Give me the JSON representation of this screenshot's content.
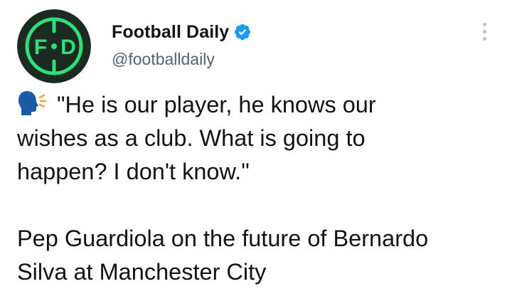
{
  "tweet": {
    "author": {
      "display_name": "Football Daily",
      "handle": "@footballdaily",
      "verified": true,
      "avatar_text": "F·D"
    },
    "more_options_icon": "three-dots-vertical-icon",
    "body": {
      "emoji_icon": "speaking-head-icon",
      "quote_line_1": "\"He is our player, he knows our",
      "quote_line_2": "wishes as a club. What is going to",
      "quote_line_3": "happen? I don't know.\"",
      "caption_line_1": "Pep Guardiola on the future of Bernardo",
      "caption_line_2": "Silva at Manchester City"
    }
  },
  "colors": {
    "avatar_bg": "#1c2b21",
    "avatar_ring": "#2de07a",
    "verified": "#1d9bf0",
    "text_primary": "#0f1419",
    "text_secondary": "#536471",
    "emoji_head": "#1d5aa6"
  }
}
